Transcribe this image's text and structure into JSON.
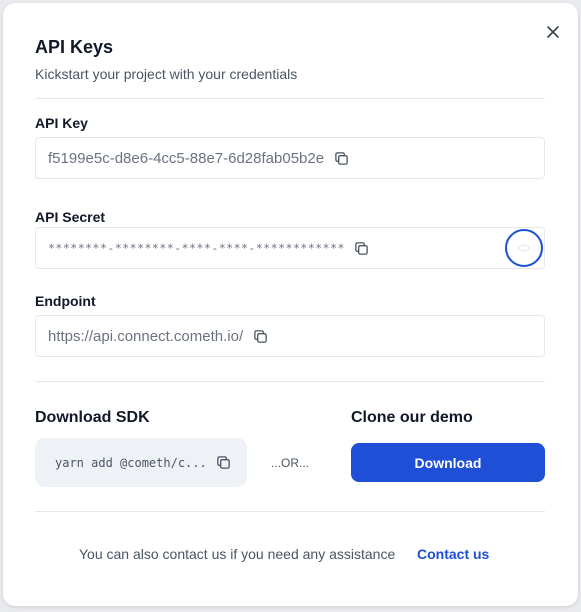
{
  "modal": {
    "title": "API Keys",
    "subtitle": "Kickstart your project with your credentials"
  },
  "fields": {
    "api_key": {
      "label": "API Key",
      "value": "f5199e5c-d8e6-4cc5-88e7-6d28fab05b2e"
    },
    "api_secret": {
      "label": "API Secret",
      "value": "********-********-****-****-************"
    },
    "endpoint": {
      "label": "Endpoint",
      "value": "https://api.connect.cometh.io/"
    }
  },
  "sdk": {
    "title": "Download SDK",
    "command": "yarn add @cometh/c..."
  },
  "demo": {
    "title": "Clone our demo",
    "or_text": "...OR...",
    "download_label": "Download"
  },
  "footer": {
    "text": "You can also contact us if you need any assistance",
    "link_label": "Contact us"
  },
  "colors": {
    "accent": "#1e4fd6",
    "muted_text": "#6b7280",
    "sdk_background": "#eef1f6"
  },
  "icons": {
    "close": "close-icon",
    "copy": "copy-icon",
    "toggle": "eye-icon"
  }
}
